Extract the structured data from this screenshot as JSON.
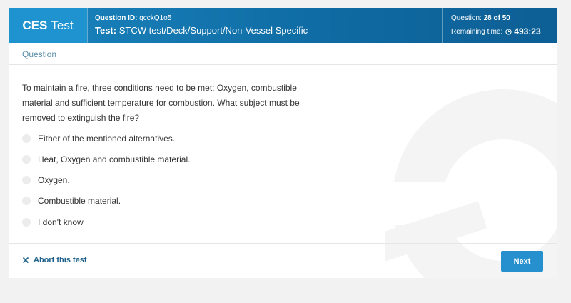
{
  "header": {
    "brand_bold": "CES",
    "brand_light": "Test",
    "question_id_label": "Question ID:",
    "question_id_value": "qcckQ1o5",
    "test_label": "Test:",
    "test_value": "STCW test/Deck/Support/Non-Vessel Specific",
    "question_count_label": "Question:",
    "question_count_value": "28 of 50",
    "remaining_label": "Remaining time:",
    "remaining_value": "493:23"
  },
  "card": {
    "title": "Question",
    "question_text": "To maintain a fire, three conditions need to be met: Oxygen, combustible material and sufficient temperature for combustion. What subject must be removed to extinguish the fire?",
    "options": [
      {
        "label": "Either of the mentioned alternatives."
      },
      {
        "label": "Heat, Oxygen and combustible material."
      },
      {
        "label": "Oxygen."
      },
      {
        "label": "Combustible material."
      },
      {
        "label": "I don't know"
      }
    ]
  },
  "footer": {
    "abort_label": "Abort this test",
    "next_label": "Next"
  },
  "colors": {
    "brand": "#1f93cf",
    "header": "#0f6aa2",
    "primary_button": "#2690cf",
    "link": "#1b5f8a"
  },
  "icons": {
    "timer": "clock-icon",
    "abort": "close-icon"
  }
}
